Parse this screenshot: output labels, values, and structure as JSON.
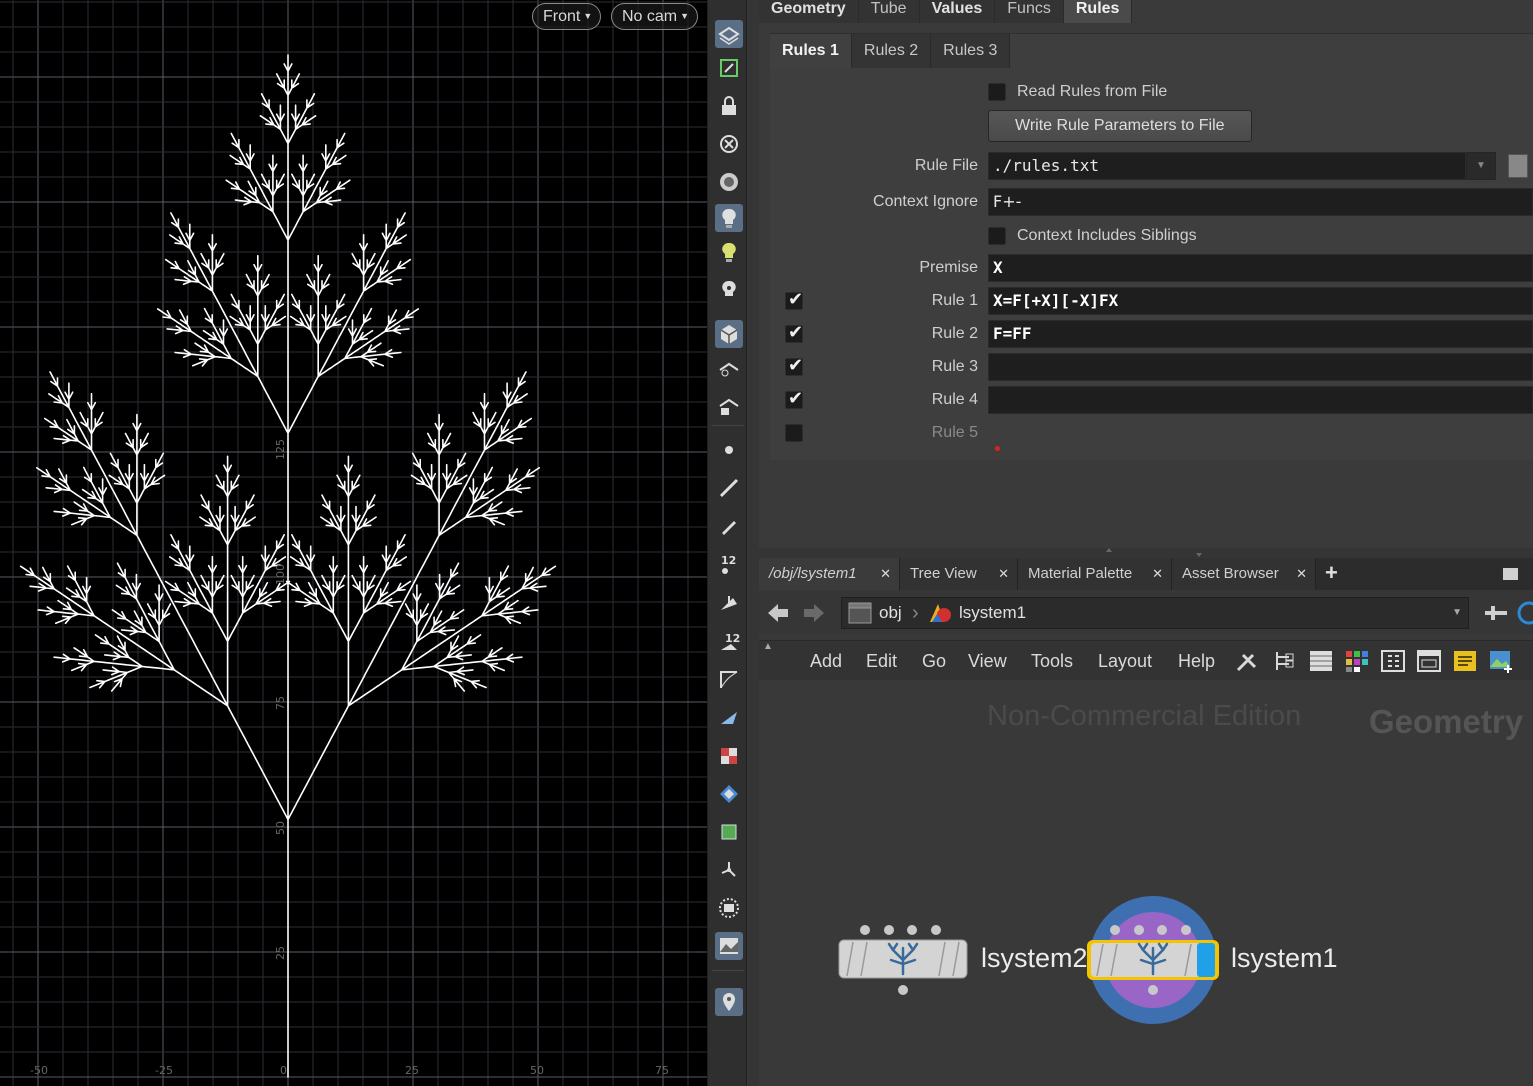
{
  "viewport": {
    "view_menu": "Front",
    "camera_menu": "No cam",
    "axis_ticks": [
      "-50",
      "-25",
      "0",
      "25",
      "50",
      "75"
    ],
    "vertical_ticks": [
      "25",
      "50",
      "75",
      "100",
      "125"
    ]
  },
  "toolbar": {
    "icons": [
      "select-mode-icon",
      "display-options-icon",
      "lock-icon",
      "snap-icon",
      "camera-icon",
      "light-icon",
      "light-2-icon",
      "headlight-icon",
      "shading-icon",
      "ghost-icon",
      "ghost-visualize-icon",
      "point-icon",
      "brush-icon",
      "pen-icon",
      "number-points-icon",
      "normals-icon",
      "number-prims-icon",
      "curve-icon",
      "uv-icon",
      "texture-icon",
      "reference-plane-icon",
      "bounding-box-icon",
      "pivot-icon",
      "safe-area-icon",
      "background-image-icon",
      "pin-icon"
    ]
  },
  "params": {
    "tabs": [
      "Geometry",
      "Tube",
      "Values",
      "Funcs",
      "Rules"
    ],
    "active_tab": "Rules",
    "sub_tabs": [
      "Rules 1",
      "Rules 2",
      "Rules 3"
    ],
    "active_sub_tab": "Rules 1",
    "read_rules_label": "Read Rules from File",
    "write_rules_button": "Write Rule Parameters to File",
    "rule_file_label": "Rule File",
    "rule_file_value": "./rules.txt",
    "context_ignore_label": "Context Ignore",
    "context_ignore_value": "F+-",
    "context_siblings_label": "Context Includes Siblings",
    "premise_label": "Premise",
    "premise_value": "X",
    "rules": [
      {
        "label": "Rule 1",
        "value": "X=F[+X][-X]FX",
        "checked": true
      },
      {
        "label": "Rule 2",
        "value": "F=FF",
        "checked": true
      },
      {
        "label": "Rule 3",
        "value": "",
        "checked": true
      },
      {
        "label": "Rule 4",
        "value": "",
        "checked": true
      },
      {
        "label": "Rule 5",
        "value": "",
        "checked": false
      }
    ]
  },
  "network": {
    "tabs": [
      "/obj/lsystem1",
      "Tree View",
      "Material Palette",
      "Asset Browser"
    ],
    "add_tab": "+",
    "path": [
      "obj",
      "lsystem1"
    ],
    "menu": [
      "Add",
      "Edit",
      "Go",
      "View",
      "Tools",
      "Layout",
      "Help"
    ],
    "watermark": "Non-Commercial Edition",
    "context_label": "Geometry",
    "nodes": [
      {
        "name": "lsystem2",
        "selected": false
      },
      {
        "name": "lsystem1",
        "selected": true
      }
    ]
  },
  "colors": {
    "accent_blue": "#1fa0e8",
    "selected_outline": "#f5c400",
    "display_ring": "#3e6fb0",
    "render_ring": "#9966c8"
  }
}
